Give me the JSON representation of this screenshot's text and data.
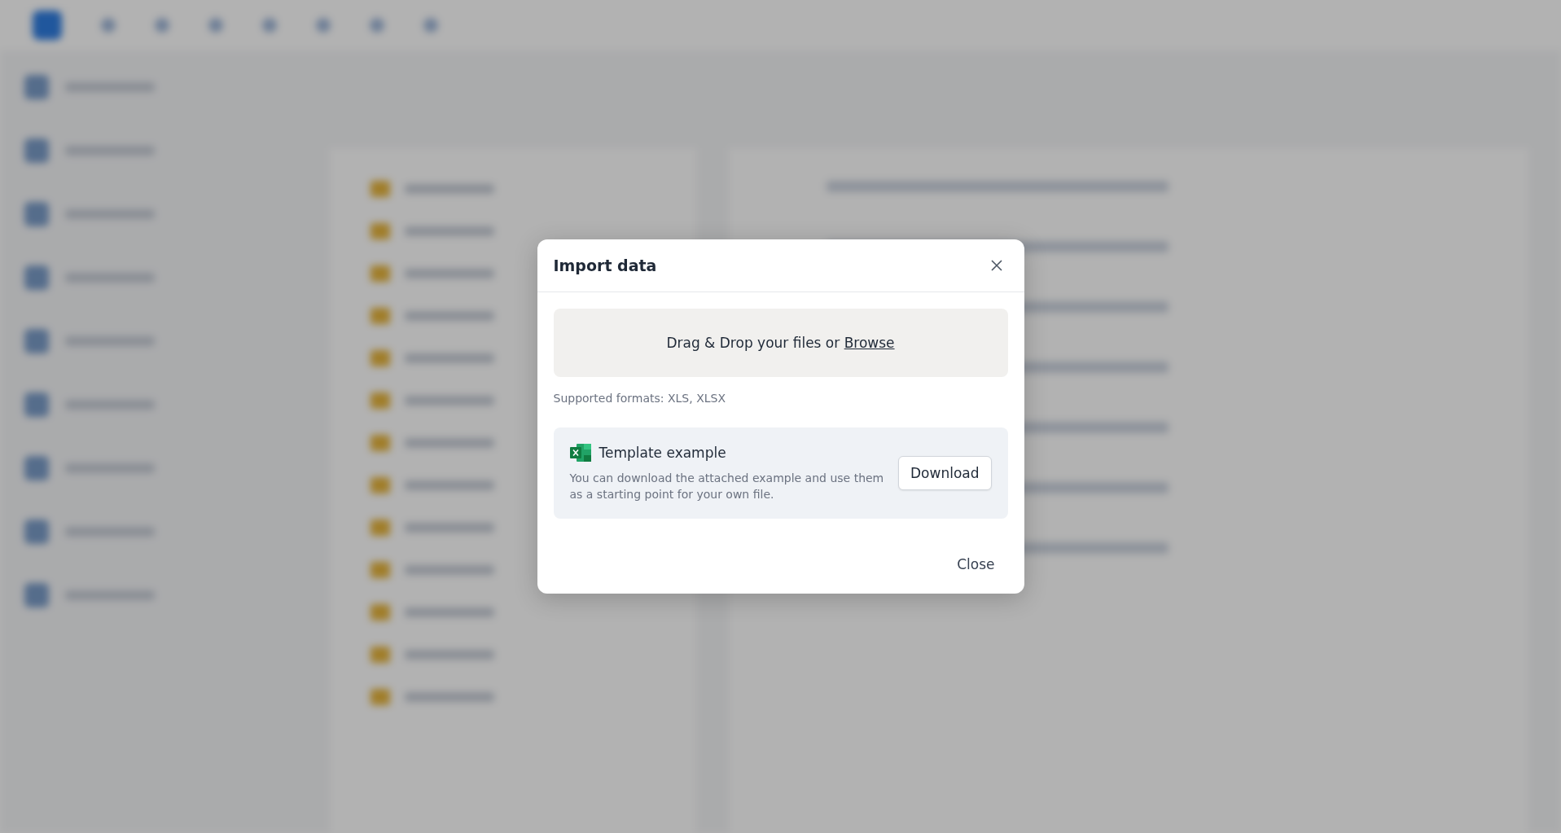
{
  "dialog": {
    "title": "Import data",
    "dropzone": {
      "text": "Drag & Drop your files or ",
      "link": "Browse"
    },
    "formats": "Supported formats: XLS, XLSX",
    "template": {
      "title": "Template example",
      "description": "You can download the attached example and use them as a starting point for your own file.",
      "button": "Download"
    },
    "buttons": [
      "Close"
    ]
  }
}
